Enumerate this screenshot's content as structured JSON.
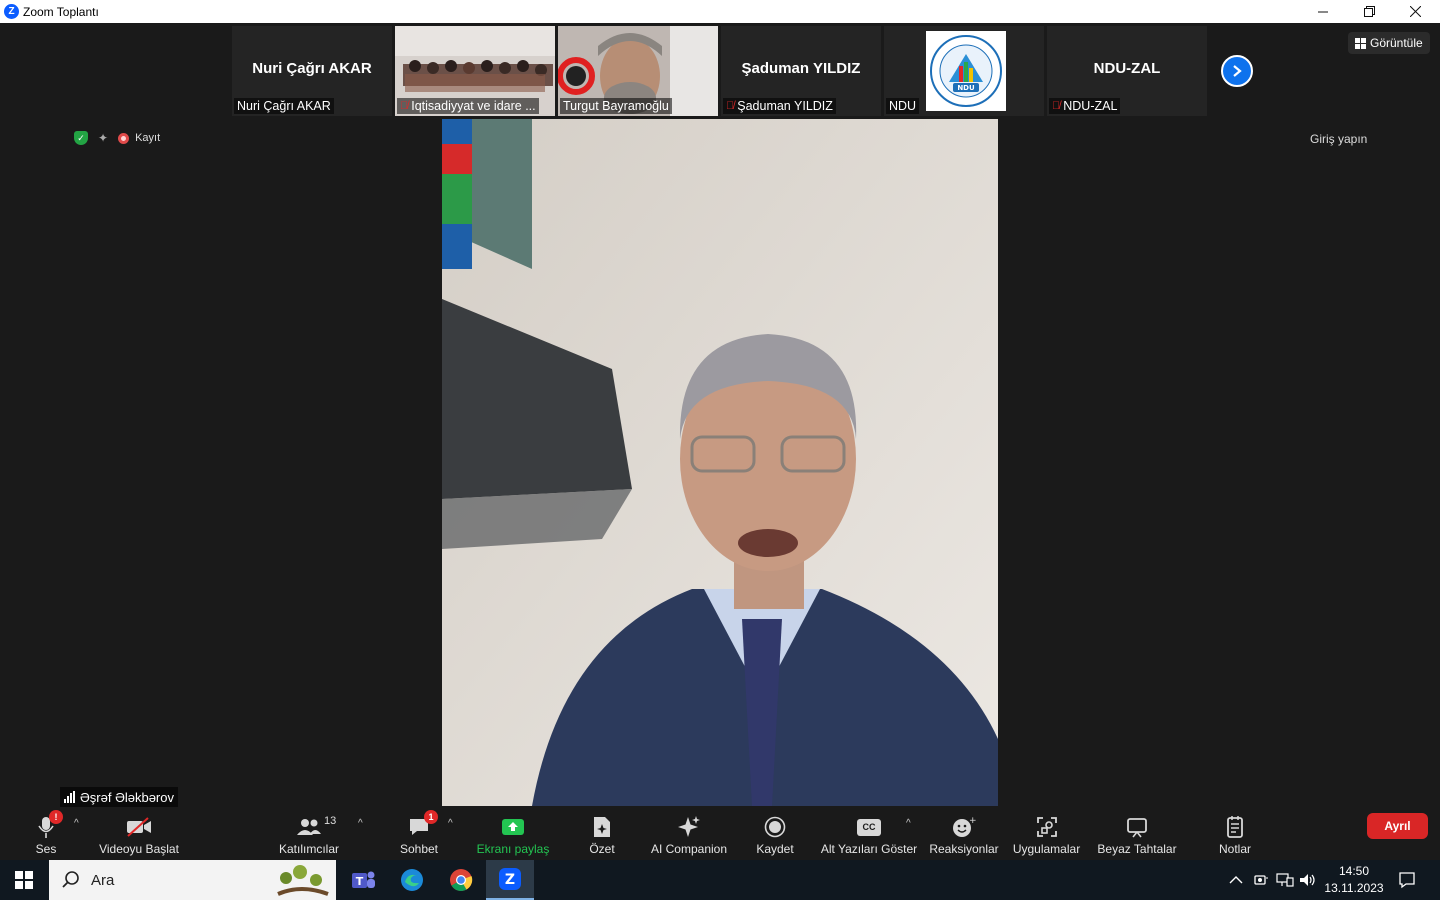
{
  "window": {
    "title": "Zoom Toplantı"
  },
  "strip": {
    "tiles": [
      {
        "big_name": "Nuri Çağrı AKAR",
        "label": "Nuri Çağrı AKAR",
        "muted": false
      },
      {
        "big_name": "",
        "label": "Iqtisadiyyat ve idare ...",
        "muted": true
      },
      {
        "big_name": "",
        "label": "Turgut Bayramoğlu",
        "muted": false
      },
      {
        "big_name": "Şaduman YILDIZ",
        "label": "Şaduman YILDIZ",
        "muted": true
      },
      {
        "big_name": "",
        "label": "NDU",
        "muted": false
      },
      {
        "big_name": "NDU-ZAL",
        "label": "NDU-ZAL",
        "muted": true
      }
    ],
    "ndu_logo_text": "NDU"
  },
  "view_button": "Görüntüle",
  "status": {
    "recording": "Kayıt"
  },
  "login": "Giriş yapın",
  "speaker": {
    "name": "Əşrəf Ələkbərov"
  },
  "toolbar": {
    "audio": "Ses",
    "video": "Videoyu Başlat",
    "participants": "Katılımcılar",
    "participants_count": "13",
    "chat": "Sohbet",
    "chat_badge": "1",
    "audio_badge": "!",
    "share": "Ekranı paylaş",
    "summary": "Özet",
    "ai": "AI Companion",
    "record": "Kaydet",
    "captions": "Alt Yazıları Göster",
    "captions_icon": "CC",
    "reactions": "Reaksiyonlar",
    "apps": "Uygulamalar",
    "whiteboard": "Beyaz Tahtalar",
    "notes": "Notlar",
    "leave": "Ayrıl"
  },
  "taskbar": {
    "search_placeholder": "Ara",
    "time": "14:50",
    "date": "13.11.2023"
  },
  "colors": {
    "accent": "#0e72ed",
    "share_green": "#23c552",
    "leave_red": "#d92626"
  }
}
